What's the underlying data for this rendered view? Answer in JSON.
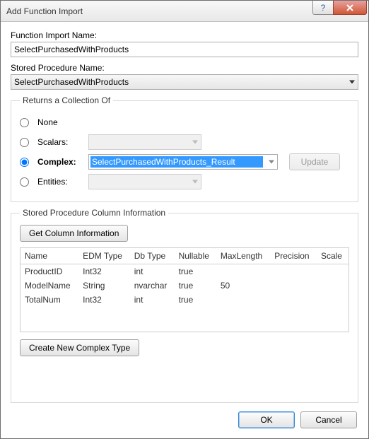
{
  "window": {
    "title": "Add Function Import"
  },
  "labels": {
    "functionImportName": "Function Import Name:",
    "storedProcedureName": "Stored Procedure Name:",
    "returnsCollectionOf": "Returns a Collection Of",
    "storedProcColumnInfo": "Stored Procedure Column Information"
  },
  "fields": {
    "functionImportName": "SelectPurchasedWithProducts",
    "storedProcedureName": "SelectPurchasedWithProducts"
  },
  "returns": {
    "options": {
      "none": "None",
      "scalars": "Scalars:",
      "complex": "Complex:",
      "entities": "Entities:"
    },
    "selected": "complex",
    "complexValue": "SelectPurchasedWithProducts_Result",
    "updateLabel": "Update"
  },
  "buttons": {
    "getColumnInfo": "Get Column Information",
    "createNewComplexType": "Create New Complex Type",
    "ok": "OK",
    "cancel": "Cancel"
  },
  "columns": {
    "headers": [
      "Name",
      "EDM Type",
      "Db Type",
      "Nullable",
      "MaxLength",
      "Precision",
      "Scale"
    ],
    "rows": [
      {
        "Name": "ProductID",
        "EDM Type": "Int32",
        "Db Type": "int",
        "Nullable": "true",
        "MaxLength": "",
        "Precision": "",
        "Scale": ""
      },
      {
        "Name": "ModelName",
        "EDM Type": "String",
        "Db Type": "nvarchar",
        "Nullable": "true",
        "MaxLength": "50",
        "Precision": "",
        "Scale": ""
      },
      {
        "Name": "TotalNum",
        "EDM Type": "Int32",
        "Db Type": "int",
        "Nullable": "true",
        "MaxLength": "",
        "Precision": "",
        "Scale": ""
      }
    ]
  }
}
